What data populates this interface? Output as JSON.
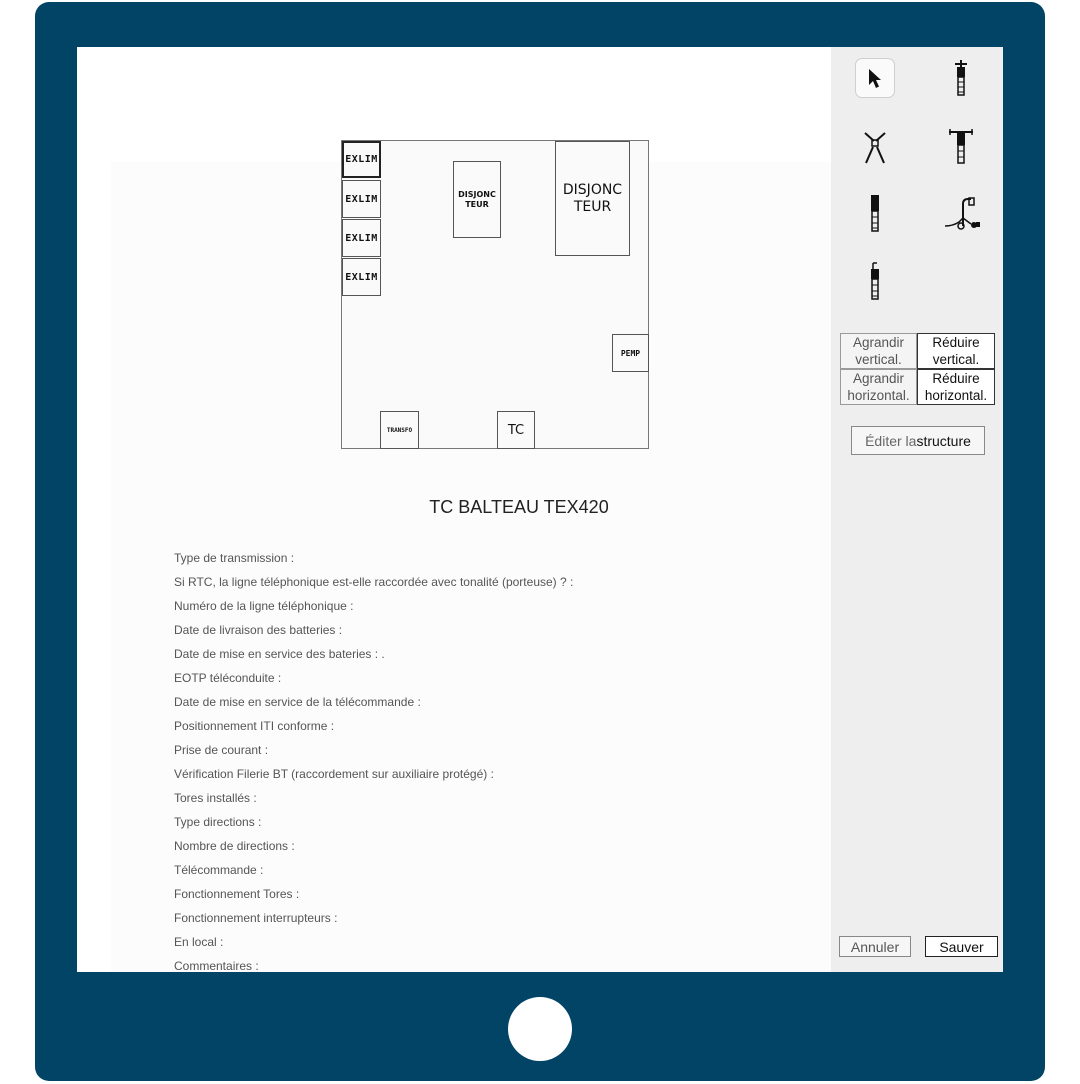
{
  "plan": {
    "exlim_1": "EXLIM",
    "exlim_2": "EXLIM",
    "exlim_3": "EXLIM",
    "exlim_4": "EXLIM",
    "disjoncteur_small_l1": "DISJONC",
    "disjoncteur_small_l2": "TEUR",
    "disjoncteur_big_l1": "DISJONC",
    "disjoncteur_big_l2": "TEUR",
    "pemp": "PEMP",
    "transfo": "TRANSFO",
    "tc": "TC"
  },
  "details": {
    "title": "TC BALTEAU TEX420",
    "fields": [
      "Type de transmission :",
      "Si RTC, la ligne téléphonique est-elle raccordée avec tonalité (porteuse) ? :",
      "Numéro de la ligne téléphonique :",
      "Date de livraison des batteries :",
      "Date de mise en service des bateries : .",
      "EOTP téléconduite :",
      "Date de mise en service de la télécommande :",
      "Positionnement ITI conforme :",
      "Prise de courant :",
      "Vérification Filerie BT (raccordement sur auxiliaire protégé) :",
      "Tores installés :",
      "Type directions :",
      "Nombre de directions :",
      "Télécommande :",
      "Fonctionnement Tores :",
      "Fonctionnement interrupteurs :",
      "En local :",
      "Commentaires :"
    ]
  },
  "panel": {
    "tools": [
      "cursor-icon",
      "pole-top-icon",
      "fork-pole-icon",
      "t-pole-icon",
      "pole-icon",
      "cable-reel-icon",
      "short-pole-icon"
    ],
    "agrandir_vertical_l1": "Agrandir",
    "agrandir_vertical_l2": "vertical.",
    "reduire_vertical_l1": "Réduire",
    "reduire_vertical_l2": "vertical.",
    "agrandir_horizontal_l1": "Agrandir",
    "agrandir_horizontal_l2": "horizontal.",
    "reduire_horizontal_l1": "Réduire",
    "reduire_horizontal_l2": "horizontal.",
    "edit_structure_a": "Éditer la",
    "edit_structure_b": " structure",
    "cancel": "Annuler",
    "save": "Sauver"
  },
  "colors": {
    "frame": "#024466",
    "panel_bg": "#eeeeee"
  }
}
